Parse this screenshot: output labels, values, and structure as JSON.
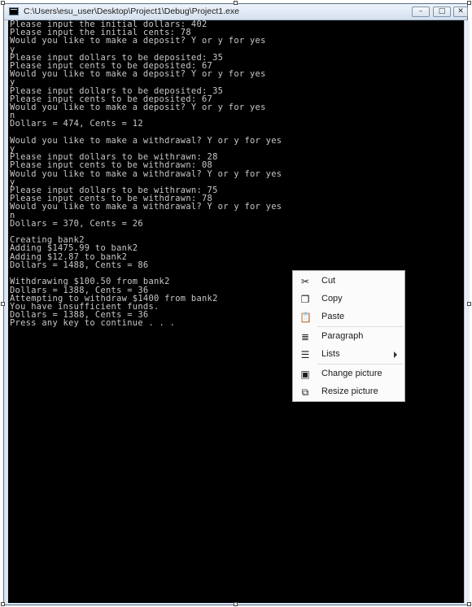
{
  "window": {
    "title": "C:\\Users\\esu_user\\Desktop\\Project1\\Debug\\Project1.exe",
    "buttons": {
      "minimize": "–",
      "maximize": "□",
      "close": "✕"
    }
  },
  "console": {
    "lines": [
      "Please input the initial dollars: 402",
      "Please input the initial cents: 78",
      "Would you like to make a deposit? Y or y for yes",
      "y",
      "Please input dollars to be deposited: 35",
      "Please input cents to be deposited: 67",
      "Would you like to make a deposit? Y or y for yes",
      "y",
      "Please input dollars to be deposited: 35",
      "Please input cents to be deposited: 67",
      "Would you like to make a deposit? Y or y for yes",
      "n",
      "Dollars = 474, Cents = 12",
      "",
      "Would you like to make a withdrawal? Y or y for yes",
      "y",
      "Please input dollars to be withrawn: 28",
      "Please input cents to be withdrawn: 08",
      "Would you like to make a withdrawal? Y or y for yes",
      "y",
      "Please input dollars to be withrawn: 75",
      "Please input cents to be withdrawn: 78",
      "Would you like to make a withdrawal? Y or y for yes",
      "n",
      "Dollars = 370, Cents = 26",
      "",
      "Creating bank2",
      "Adding $1475.99 to bank2",
      "Adding $12.87 to bank2",
      "Dollars = 1488, Cents = 86",
      "",
      "Withdrawing $100.50 from bank2",
      "Dollars = 1388, Cents = 36",
      "Attempting to withdraw $1400 from bank2",
      "You have insufficient funds.",
      "Dollars = 1388, Cents = 36",
      "Press any key to continue . . ."
    ]
  },
  "context_menu": {
    "items": [
      {
        "label": "Cut",
        "icon": "scissors-icon",
        "glyph": "✂"
      },
      {
        "label": "Copy",
        "icon": "copy-icon",
        "glyph": "❐"
      },
      {
        "label": "Paste",
        "icon": "paste-icon",
        "glyph": "📋"
      },
      {
        "label": "Paragraph",
        "icon": "paragraph-icon",
        "glyph": "≣"
      },
      {
        "label": "Lists",
        "icon": "list-icon",
        "glyph": "☰"
      },
      {
        "label": "Change picture",
        "icon": "change-picture-icon",
        "glyph": "▣"
      },
      {
        "label": "Resize picture",
        "icon": "resize-picture-icon",
        "glyph": "⧉"
      }
    ]
  }
}
